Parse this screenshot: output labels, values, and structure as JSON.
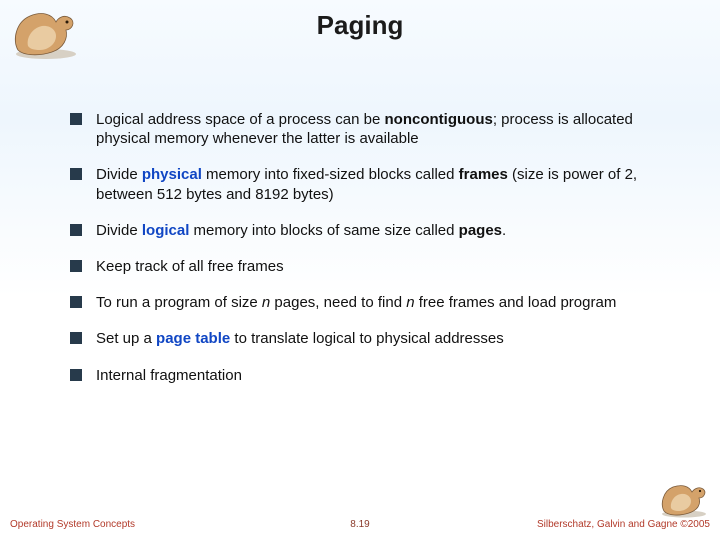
{
  "title": "Paging",
  "bullets": [
    {
      "html": "Logical address space of a process can be <b>noncontiguous</b>; process is allocated physical memory whenever the latter is available"
    },
    {
      "html": "Divide <span class=\"hl\">physical</span> memory into fixed-sized blocks called <b>frames</b> (size is power of 2, between 512 bytes and 8192 bytes)"
    },
    {
      "html": "Divide <span class=\"hl\">logical</span> memory into blocks of same size called <b>pages</b>."
    },
    {
      "html": "Keep track of all free frames"
    },
    {
      "html": "To run a program of size <span class=\"ital\">n</span> pages, need to find <span class=\"ital\">n</span> free frames and load program"
    },
    {
      "html": "Set up a <span class=\"hl\">page table</span> to translate logical to physical addresses"
    },
    {
      "html": "Internal fragmentation"
    }
  ],
  "footer": {
    "left": "Operating System Concepts",
    "center": "8.19",
    "right": "Silberschatz, Galvin and Gagne ©2005"
  }
}
